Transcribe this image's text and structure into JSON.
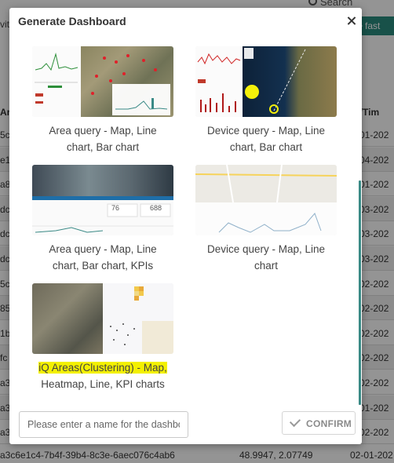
{
  "background": {
    "search_label": "Search",
    "fast_button": "fast",
    "left_partial": "viti",
    "headers": {
      "left": "Ar",
      "right": "e/Tim"
    },
    "rows": [
      {
        "left": "5c",
        "right": "01-202"
      },
      {
        "left": "e1",
        "right": "04-202"
      },
      {
        "left": "a8",
        "right": "01-202"
      },
      {
        "left": "dc",
        "right": "03-202"
      },
      {
        "left": "dc",
        "right": "03-202"
      },
      {
        "left": "dc",
        "right": "03-202"
      },
      {
        "left": "5c",
        "right": "02-202"
      },
      {
        "left": "85",
        "right": "02-202"
      },
      {
        "left": "1b",
        "right": "02-202"
      },
      {
        "left": "fc",
        "right": "02-202"
      },
      {
        "left": "a3",
        "right": "02-202"
      },
      {
        "left": "a3",
        "right": "01-202"
      },
      {
        "left": "a3",
        "right": "02-202"
      }
    ],
    "last_row": {
      "id": "a3c6e1c4-7b4f-39b4-8c3e-6aec076c4ab6",
      "coords": "48.9947, 2.07749",
      "date": "02-01-202"
    }
  },
  "modal": {
    "title": "Generate Dashboard",
    "options": [
      {
        "label_line1": "Area query - Map, Line",
        "label_line2": "chart, Bar chart"
      },
      {
        "label_line1": "Device query - Map, Line",
        "label_line2": "chart, Bar chart"
      },
      {
        "label_line1": "Area query - Map, Line",
        "label_line2": "chart, Bar chart, KPIs"
      },
      {
        "label_line1": "Device query - Map, Line",
        "label_line2": "chart"
      },
      {
        "label_line1": "iQ Areas(Clustering) - Map,",
        "label_line2": "Heatmap, Line, KPI charts"
      }
    ],
    "kpi_values": {
      "left": "76",
      "right": "688"
    },
    "name_input": {
      "placeholder": "Please enter a name for the dashboard",
      "value": ""
    },
    "confirm_label": "CONFIRM"
  },
  "colors": {
    "accent": "#2a8c7e",
    "highlight": "#f3f000",
    "scrollbar": "#3a8a86"
  }
}
